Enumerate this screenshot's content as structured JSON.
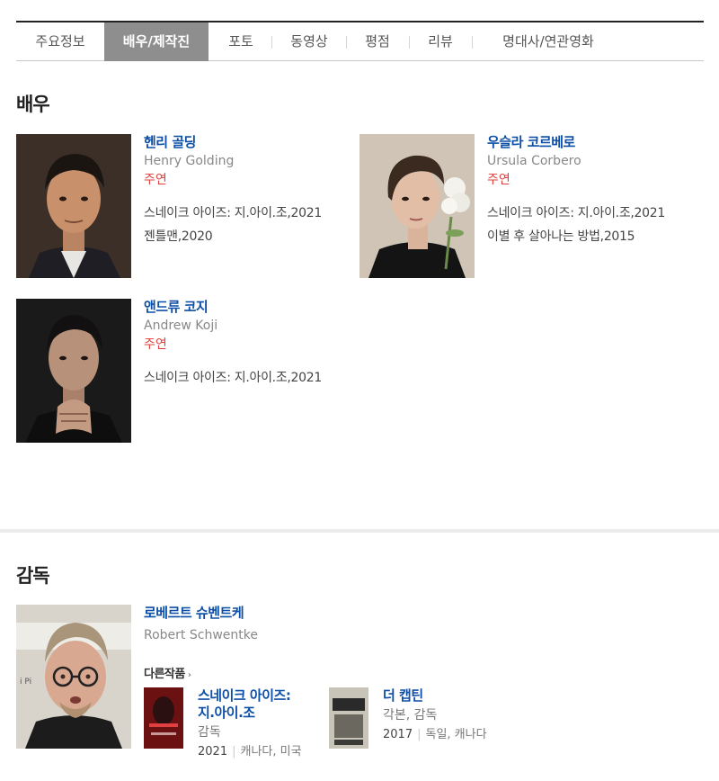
{
  "tabs": [
    {
      "label": "주요정보",
      "active": false
    },
    {
      "label": "배우/제작진",
      "active": true
    },
    {
      "label": "포토",
      "active": false
    },
    {
      "label": "동영상",
      "active": false
    },
    {
      "label": "평점",
      "active": false
    },
    {
      "label": "리뷰",
      "active": false
    },
    {
      "label": "명대사/연관영화",
      "active": false
    }
  ],
  "actors_section": {
    "title": "배우",
    "actors": [
      {
        "name_ko": "헨리 골딩",
        "name_en": "Henry Golding",
        "role": "주연",
        "works": [
          "스네이크 아이즈: 지.아이.조,2021",
          "젠틀맨,2020"
        ]
      },
      {
        "name_ko": "우슬라 코르베로",
        "name_en": "Ursula Corbero",
        "role": "주연",
        "works": [
          "스네이크 아이즈: 지.아이.조,2021",
          "이별 후 살아나는 방법,2015"
        ]
      },
      {
        "name_ko": "앤드류 코지",
        "name_en": "Andrew Koji",
        "role": "주연",
        "works": [
          "스네이크 아이즈: 지.아이.조,2021"
        ]
      }
    ]
  },
  "director_section": {
    "title": "감독",
    "director": {
      "name_ko": "로베르트 슈벤트케",
      "name_en": "Robert Schwentke"
    },
    "other_works_label": "다른작품",
    "films": [
      {
        "title_line1": "스네이크 아이즈:",
        "title_line2": "지.아이.조",
        "credit": "감독",
        "year": "2021",
        "country": "캐나다, 미국"
      },
      {
        "title_line1": "더 캡틴",
        "title_line2": "",
        "credit": "각본, 감독",
        "year": "2017",
        "country": "독일, 캐나다"
      }
    ]
  },
  "colors": {
    "link": "#0d4fa6",
    "role": "#e0413b",
    "active_tab_bg": "#8e8e8e"
  }
}
